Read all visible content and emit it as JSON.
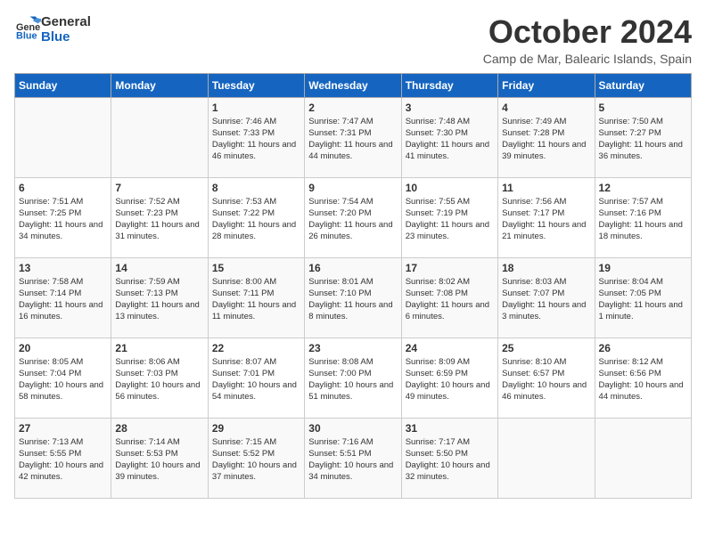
{
  "header": {
    "logo_general": "General",
    "logo_blue": "Blue",
    "month_title": "October 2024",
    "location": "Camp de Mar, Balearic Islands, Spain"
  },
  "weekdays": [
    "Sunday",
    "Monday",
    "Tuesday",
    "Wednesday",
    "Thursday",
    "Friday",
    "Saturday"
  ],
  "weeks": [
    [
      {
        "day": "",
        "info": ""
      },
      {
        "day": "",
        "info": ""
      },
      {
        "day": "1",
        "info": "Sunrise: 7:46 AM\nSunset: 7:33 PM\nDaylight: 11 hours and 46 minutes."
      },
      {
        "day": "2",
        "info": "Sunrise: 7:47 AM\nSunset: 7:31 PM\nDaylight: 11 hours and 44 minutes."
      },
      {
        "day": "3",
        "info": "Sunrise: 7:48 AM\nSunset: 7:30 PM\nDaylight: 11 hours and 41 minutes."
      },
      {
        "day": "4",
        "info": "Sunrise: 7:49 AM\nSunset: 7:28 PM\nDaylight: 11 hours and 39 minutes."
      },
      {
        "day": "5",
        "info": "Sunrise: 7:50 AM\nSunset: 7:27 PM\nDaylight: 11 hours and 36 minutes."
      }
    ],
    [
      {
        "day": "6",
        "info": "Sunrise: 7:51 AM\nSunset: 7:25 PM\nDaylight: 11 hours and 34 minutes."
      },
      {
        "day": "7",
        "info": "Sunrise: 7:52 AM\nSunset: 7:23 PM\nDaylight: 11 hours and 31 minutes."
      },
      {
        "day": "8",
        "info": "Sunrise: 7:53 AM\nSunset: 7:22 PM\nDaylight: 11 hours and 28 minutes."
      },
      {
        "day": "9",
        "info": "Sunrise: 7:54 AM\nSunset: 7:20 PM\nDaylight: 11 hours and 26 minutes."
      },
      {
        "day": "10",
        "info": "Sunrise: 7:55 AM\nSunset: 7:19 PM\nDaylight: 11 hours and 23 minutes."
      },
      {
        "day": "11",
        "info": "Sunrise: 7:56 AM\nSunset: 7:17 PM\nDaylight: 11 hours and 21 minutes."
      },
      {
        "day": "12",
        "info": "Sunrise: 7:57 AM\nSunset: 7:16 PM\nDaylight: 11 hours and 18 minutes."
      }
    ],
    [
      {
        "day": "13",
        "info": "Sunrise: 7:58 AM\nSunset: 7:14 PM\nDaylight: 11 hours and 16 minutes."
      },
      {
        "day": "14",
        "info": "Sunrise: 7:59 AM\nSunset: 7:13 PM\nDaylight: 11 hours and 13 minutes."
      },
      {
        "day": "15",
        "info": "Sunrise: 8:00 AM\nSunset: 7:11 PM\nDaylight: 11 hours and 11 minutes."
      },
      {
        "day": "16",
        "info": "Sunrise: 8:01 AM\nSunset: 7:10 PM\nDaylight: 11 hours and 8 minutes."
      },
      {
        "day": "17",
        "info": "Sunrise: 8:02 AM\nSunset: 7:08 PM\nDaylight: 11 hours and 6 minutes."
      },
      {
        "day": "18",
        "info": "Sunrise: 8:03 AM\nSunset: 7:07 PM\nDaylight: 11 hours and 3 minutes."
      },
      {
        "day": "19",
        "info": "Sunrise: 8:04 AM\nSunset: 7:05 PM\nDaylight: 11 hours and 1 minute."
      }
    ],
    [
      {
        "day": "20",
        "info": "Sunrise: 8:05 AM\nSunset: 7:04 PM\nDaylight: 10 hours and 58 minutes."
      },
      {
        "day": "21",
        "info": "Sunrise: 8:06 AM\nSunset: 7:03 PM\nDaylight: 10 hours and 56 minutes."
      },
      {
        "day": "22",
        "info": "Sunrise: 8:07 AM\nSunset: 7:01 PM\nDaylight: 10 hours and 54 minutes."
      },
      {
        "day": "23",
        "info": "Sunrise: 8:08 AM\nSunset: 7:00 PM\nDaylight: 10 hours and 51 minutes."
      },
      {
        "day": "24",
        "info": "Sunrise: 8:09 AM\nSunset: 6:59 PM\nDaylight: 10 hours and 49 minutes."
      },
      {
        "day": "25",
        "info": "Sunrise: 8:10 AM\nSunset: 6:57 PM\nDaylight: 10 hours and 46 minutes."
      },
      {
        "day": "26",
        "info": "Sunrise: 8:12 AM\nSunset: 6:56 PM\nDaylight: 10 hours and 44 minutes."
      }
    ],
    [
      {
        "day": "27",
        "info": "Sunrise: 7:13 AM\nSunset: 5:55 PM\nDaylight: 10 hours and 42 minutes."
      },
      {
        "day": "28",
        "info": "Sunrise: 7:14 AM\nSunset: 5:53 PM\nDaylight: 10 hours and 39 minutes."
      },
      {
        "day": "29",
        "info": "Sunrise: 7:15 AM\nSunset: 5:52 PM\nDaylight: 10 hours and 37 minutes."
      },
      {
        "day": "30",
        "info": "Sunrise: 7:16 AM\nSunset: 5:51 PM\nDaylight: 10 hours and 34 minutes."
      },
      {
        "day": "31",
        "info": "Sunrise: 7:17 AM\nSunset: 5:50 PM\nDaylight: 10 hours and 32 minutes."
      },
      {
        "day": "",
        "info": ""
      },
      {
        "day": "",
        "info": ""
      }
    ]
  ]
}
